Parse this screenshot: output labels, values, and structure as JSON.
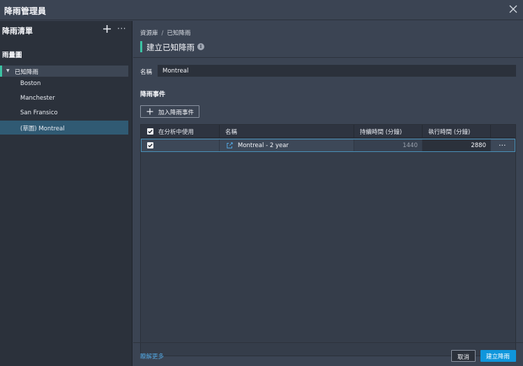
{
  "window": {
    "title": "降雨管理員"
  },
  "sidebar": {
    "title": "降雨清單",
    "subtitle": "雨量圖",
    "group_label": "已知降雨",
    "items": [
      {
        "label": "Boston"
      },
      {
        "label": "Manchester"
      },
      {
        "label": "San Fransico"
      },
      {
        "label": "(草圖) Montreal",
        "selected": true
      }
    ]
  },
  "main": {
    "breadcrumb": {
      "root": "資源庫",
      "separator": "/",
      "current": "已知降雨"
    },
    "page_title": "建立已知降雨",
    "name_label": "名稱",
    "name_value": "Montreal",
    "section_title": "降雨事件",
    "add_button_label": "加入降雨事件",
    "table": {
      "headers": {
        "use": "在分析中使用",
        "name": "名稱",
        "duration": "持續時間 (分鐘)",
        "run_time": "執行時間 (分鐘)"
      },
      "rows": [
        {
          "checked": true,
          "name": "Montreal - 2 year",
          "duration": "1440",
          "run_time": "2880",
          "more": "···"
        }
      ]
    },
    "footer": {
      "learn_more": "瞭解更多",
      "cancel_label": "取消",
      "create_label": "建立降雨"
    }
  },
  "colors": {
    "accent_green": "#3cc2a3",
    "primary_blue": "#0f96dc",
    "link_blue": "#53a6e0",
    "selection": "#305a73"
  }
}
